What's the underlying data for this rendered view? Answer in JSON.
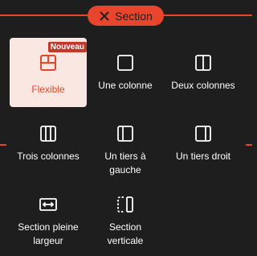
{
  "header": {
    "pill_label": "Section",
    "pill_icon": "close-icon"
  },
  "colors": {
    "accent": "#e8452c",
    "background": "#1e1e1e",
    "selected_bg": "#fae7e1",
    "badge_bg": "#c0392b"
  },
  "layouts": [
    {
      "label": "Flexible",
      "icon": "flexible-layout-icon",
      "badge": "Nouveau",
      "selected": true
    },
    {
      "label": "Une colonne",
      "icon": "one-column-icon"
    },
    {
      "label": "Deux colonnes",
      "icon": "two-columns-icon"
    },
    {
      "label": "Trois colonnes",
      "icon": "three-columns-icon"
    },
    {
      "label": "Un tiers à\ngauche",
      "icon": "one-third-left-icon"
    },
    {
      "label": "Un tiers droit",
      "icon": "one-third-right-icon"
    },
    {
      "label": "Section pleine\nlargeur",
      "icon": "full-width-section-icon"
    },
    {
      "label": "Section\nverticale",
      "icon": "vertical-section-icon"
    }
  ]
}
